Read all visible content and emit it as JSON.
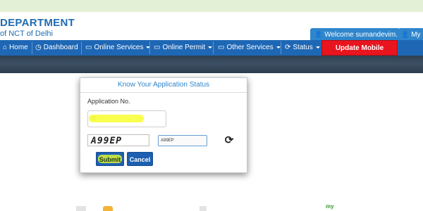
{
  "header": {
    "brand_line1": "DEPARTMENT",
    "brand_line2": "of NCT of Delhi",
    "welcome_text": "Welcome  sumandevim...",
    "my_profile_text": "My P"
  },
  "nav": {
    "items": [
      {
        "label": "Home",
        "icon": "home-icon"
      },
      {
        "label": "Dashboard",
        "icon": "dashboard-icon"
      },
      {
        "label": "Online Services",
        "icon": "monitor-icon",
        "dropdown": true
      },
      {
        "label": "Online Permit",
        "icon": "monitor-icon",
        "dropdown": true
      },
      {
        "label": "Other Services",
        "icon": "monitor-icon",
        "dropdown": true
      },
      {
        "label": "Status",
        "icon": "refresh-icon",
        "dropdown": true
      }
    ],
    "update_label": "Update Mobile Number",
    "update_color": "#e8141e",
    "bar_color": "#1e67b5"
  },
  "status_form": {
    "title": "Know Your Application Status",
    "application_label": "Application No.",
    "application_value": "DL",
    "captcha_text": "A99EP",
    "captcha_input_value": "A99EP",
    "submit_label": "Submit",
    "cancel_label": "Cancel"
  },
  "footer_fragment": {
    "text": "my"
  }
}
